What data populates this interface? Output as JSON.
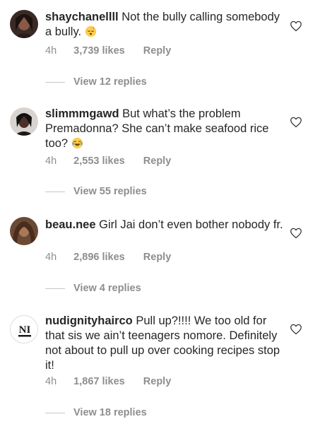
{
  "comments": [
    {
      "username": "shaychanellll",
      "text": "Not the bully calling somebody a bully.",
      "emoji": "sleeping-face-emoji",
      "time": "4h",
      "likes": "3,739 likes",
      "reply_label": "Reply",
      "view_replies": "View 12 replies"
    },
    {
      "username": "slimmmgawd",
      "text": "But what’s the problem Premadonna? She can’t make seafood rice too?",
      "emoji": "tears-of-joy-emoji",
      "time": "4h",
      "likes": "2,553 likes",
      "reply_label": "Reply",
      "view_replies": "View 55 replies"
    },
    {
      "username": "beau.nee",
      "text": "Girl Jai don’t even bother nobody fr.",
      "time": "4h",
      "likes": "2,896 likes",
      "reply_label": "Reply",
      "view_replies": "View 4 replies"
    },
    {
      "username": "nudignityhairco",
      "text": "Pull up?!!!! We too old for that sis we ain’t teenagers nomore. Definitely not about to pull up over cooking recipes stop it!",
      "logo_text": "NI",
      "time": "4h",
      "likes": "1,867 likes",
      "reply_label": "Reply",
      "view_replies": "View 18 replies"
    }
  ],
  "colors": {
    "text": "#262626",
    "secondary": "#8e8e8e",
    "divider": "#c7c7c7"
  }
}
